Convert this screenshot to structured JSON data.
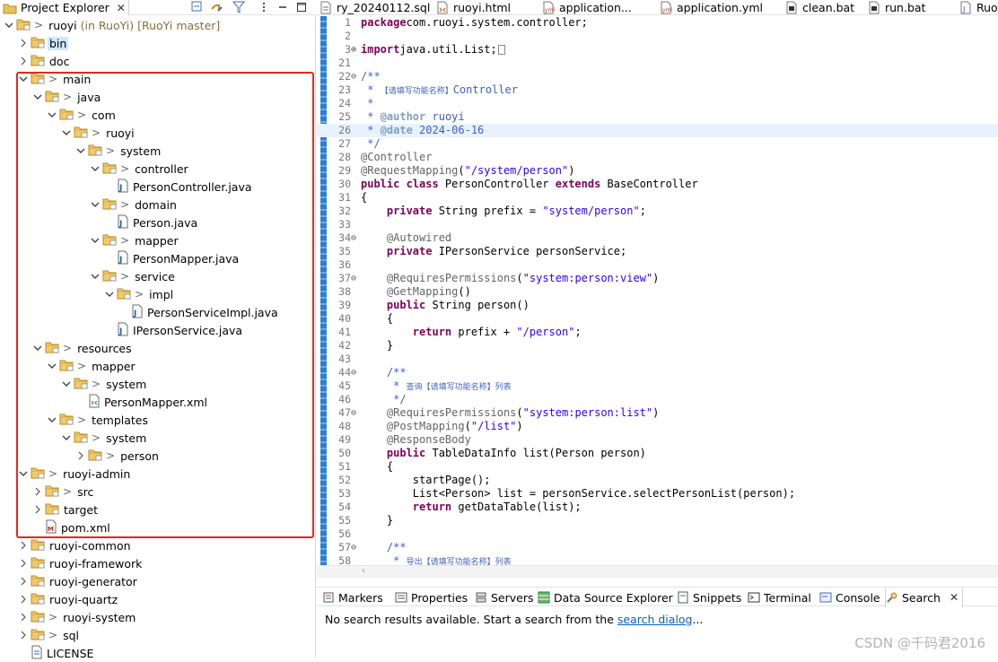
{
  "explorer": {
    "tab_title": "Project Explorer",
    "rows": [
      {
        "depth": 0,
        "twisty": "open",
        "icon": "project",
        "gt": true,
        "label": "ruoyi",
        "suffix": " (in RuoYi) [RuoYi master]"
      },
      {
        "depth": 1,
        "twisty": "closed",
        "icon": "folder",
        "gt": false,
        "label": "bin",
        "selected": true
      },
      {
        "depth": 1,
        "twisty": "closed",
        "icon": "folder",
        "gt": false,
        "label": "doc"
      },
      {
        "depth": 1,
        "twisty": "open",
        "icon": "folder",
        "gt": true,
        "label": "main"
      },
      {
        "depth": 2,
        "twisty": "open",
        "icon": "folder",
        "gt": true,
        "label": "java"
      },
      {
        "depth": 3,
        "twisty": "open",
        "icon": "folder",
        "gt": true,
        "label": "com"
      },
      {
        "depth": 4,
        "twisty": "open",
        "icon": "folder",
        "gt": true,
        "label": "ruoyi"
      },
      {
        "depth": 5,
        "twisty": "open",
        "icon": "folder",
        "gt": true,
        "label": "system"
      },
      {
        "depth": 6,
        "twisty": "open",
        "icon": "folder",
        "gt": true,
        "label": "controller"
      },
      {
        "depth": 7,
        "twisty": "none",
        "icon": "java",
        "gt": false,
        "label": "PersonController.java"
      },
      {
        "depth": 6,
        "twisty": "open",
        "icon": "folder",
        "gt": true,
        "label": "domain"
      },
      {
        "depth": 7,
        "twisty": "none",
        "icon": "java",
        "gt": false,
        "label": "Person.java"
      },
      {
        "depth": 6,
        "twisty": "open",
        "icon": "folder",
        "gt": true,
        "label": "mapper"
      },
      {
        "depth": 7,
        "twisty": "none",
        "icon": "java",
        "gt": false,
        "label": "PersonMapper.java"
      },
      {
        "depth": 6,
        "twisty": "open",
        "icon": "folder",
        "gt": true,
        "label": "service"
      },
      {
        "depth": 7,
        "twisty": "open",
        "icon": "folder",
        "gt": true,
        "label": "impl"
      },
      {
        "depth": 8,
        "twisty": "none",
        "icon": "java",
        "gt": false,
        "label": "PersonServiceImpl.java"
      },
      {
        "depth": 7,
        "twisty": "none",
        "icon": "java",
        "gt": false,
        "label": "IPersonService.java"
      },
      {
        "depth": 2,
        "twisty": "open",
        "icon": "folder",
        "gt": true,
        "label": "resources"
      },
      {
        "depth": 3,
        "twisty": "open",
        "icon": "folder",
        "gt": true,
        "label": "mapper"
      },
      {
        "depth": 4,
        "twisty": "open",
        "icon": "folder",
        "gt": true,
        "label": "system"
      },
      {
        "depth": 5,
        "twisty": "none",
        "icon": "xml",
        "gt": false,
        "label": "PersonMapper.xml"
      },
      {
        "depth": 3,
        "twisty": "open",
        "icon": "folder",
        "gt": true,
        "label": "templates"
      },
      {
        "depth": 4,
        "twisty": "open",
        "icon": "folder",
        "gt": true,
        "label": "system"
      },
      {
        "depth": 5,
        "twisty": "closed",
        "icon": "folder",
        "gt": true,
        "label": "person"
      },
      {
        "depth": 1,
        "twisty": "open",
        "icon": "folder",
        "gt": true,
        "label": "ruoyi-admin"
      },
      {
        "depth": 2,
        "twisty": "closed",
        "icon": "folder",
        "gt": true,
        "label": "src"
      },
      {
        "depth": 2,
        "twisty": "closed",
        "icon": "folder",
        "gt": false,
        "label": "target"
      },
      {
        "depth": 2,
        "twisty": "none",
        "icon": "xmlfile",
        "gt": false,
        "label": "pom.xml"
      },
      {
        "depth": 1,
        "twisty": "closed",
        "icon": "folder",
        "gt": false,
        "label": "ruoyi-common"
      },
      {
        "depth": 1,
        "twisty": "closed",
        "icon": "folder",
        "gt": false,
        "label": "ruoyi-framework"
      },
      {
        "depth": 1,
        "twisty": "closed",
        "icon": "folder",
        "gt": false,
        "label": "ruoyi-generator"
      },
      {
        "depth": 1,
        "twisty": "closed",
        "icon": "folder",
        "gt": false,
        "label": "ruoyi-quartz"
      },
      {
        "depth": 1,
        "twisty": "closed",
        "icon": "folder",
        "gt": true,
        "label": "ruoyi-system"
      },
      {
        "depth": 1,
        "twisty": "closed",
        "icon": "folder",
        "gt": true,
        "label": "sql"
      },
      {
        "depth": 1,
        "twisty": "none",
        "icon": "textfile",
        "gt": false,
        "label": "LICENSE"
      }
    ]
  },
  "editor_tabs": [
    {
      "label": "ry_20240112.sql",
      "icon": "sql-file-icon"
    },
    {
      "label": "ruoyi.html",
      "icon": "html-file-icon"
    },
    {
      "label": "application...",
      "icon": "yml-file-icon"
    },
    {
      "label": "application.yml",
      "icon": "yml-file-icon"
    },
    {
      "label": "clean.bat",
      "icon": "bat-file-icon"
    },
    {
      "label": "run.bat",
      "icon": "bat-file-icon"
    },
    {
      "label": "RuoYi",
      "icon": "java-file-icon"
    }
  ],
  "code_lines": [
    {
      "n": "1",
      "segs": [
        [
          "kw",
          "package"
        ],
        [
          "",
          "com.ruoyi.system.controller;"
        ]
      ]
    },
    {
      "n": "2",
      "segs": []
    },
    {
      "n": "3",
      "fold": "plus",
      "segs": [
        [
          "kw",
          "import"
        ],
        [
          "",
          "java.util.List;"
        ],
        [
          "box",
          ""
        ]
      ]
    },
    {
      "n": "21",
      "segs": []
    },
    {
      "n": "22",
      "fold": "minus",
      "segs": [
        [
          "jd",
          "/**"
        ]
      ]
    },
    {
      "n": "23",
      "segs": [
        [
          "jd",
          " * "
        ],
        [
          "cjk",
          "【请填写功能名称】"
        ],
        [
          "jd",
          "Controller"
        ]
      ]
    },
    {
      "n": "24",
      "segs": [
        [
          "jd",
          " *"
        ]
      ]
    },
    {
      "n": "25",
      "segs": [
        [
          "jd",
          " * "
        ],
        [
          "jdt",
          "@author"
        ],
        [
          "jd",
          " ruoyi"
        ]
      ]
    },
    {
      "n": "26",
      "hl": true,
      "segs": [
        [
          "jd",
          " * "
        ],
        [
          "jdt",
          "@date"
        ],
        [
          "jd",
          " 2024-06-16"
        ]
      ]
    },
    {
      "n": "27",
      "segs": [
        [
          "jd",
          " */"
        ]
      ]
    },
    {
      "n": "28",
      "segs": [
        [
          "ann",
          "@Controller"
        ]
      ]
    },
    {
      "n": "29",
      "segs": [
        [
          "ann",
          "@RequestMapping"
        ],
        [
          "",
          "("
        ],
        [
          "str",
          "\"/system/person\""
        ],
        [
          "",
          ")"
        ]
      ]
    },
    {
      "n": "30",
      "segs": [
        [
          "kw",
          "public class"
        ],
        [
          "",
          " PersonController "
        ],
        [
          "kw",
          "extends"
        ],
        [
          "",
          " BaseController"
        ]
      ]
    },
    {
      "n": "31",
      "segs": [
        [
          "",
          "{"
        ]
      ]
    },
    {
      "n": "32",
      "segs": [
        [
          "",
          "    "
        ],
        [
          "kw",
          "private"
        ],
        [
          "",
          " String prefix = "
        ],
        [
          "str",
          "\"system/person\""
        ],
        [
          "",
          ";"
        ]
      ]
    },
    {
      "n": "33",
      "segs": []
    },
    {
      "n": "34",
      "fold": "minus",
      "segs": [
        [
          "",
          "    "
        ],
        [
          "ann",
          "@Autowired"
        ]
      ]
    },
    {
      "n": "35",
      "segs": [
        [
          "",
          "    "
        ],
        [
          "kw",
          "private"
        ],
        [
          "",
          " IPersonService personService;"
        ]
      ]
    },
    {
      "n": "36",
      "segs": []
    },
    {
      "n": "37",
      "fold": "minus",
      "segs": [
        [
          "",
          "    "
        ],
        [
          "ann",
          "@RequiresPermissions"
        ],
        [
          "",
          "("
        ],
        [
          "str",
          "\"system:person:view\""
        ],
        [
          "",
          ")"
        ]
      ]
    },
    {
      "n": "38",
      "segs": [
        [
          "",
          "    "
        ],
        [
          "ann",
          "@GetMapping"
        ],
        [
          "",
          "()"
        ]
      ]
    },
    {
      "n": "39",
      "segs": [
        [
          "",
          "    "
        ],
        [
          "kw",
          "public"
        ],
        [
          "",
          " String person()"
        ]
      ]
    },
    {
      "n": "40",
      "segs": [
        [
          "",
          "    {"
        ]
      ]
    },
    {
      "n": "41",
      "segs": [
        [
          "",
          "        "
        ],
        [
          "kw",
          "return"
        ],
        [
          "",
          " prefix + "
        ],
        [
          "str",
          "\"/person\""
        ],
        [
          "",
          ";"
        ]
      ]
    },
    {
      "n": "42",
      "segs": [
        [
          "",
          "    }"
        ]
      ]
    },
    {
      "n": "43",
      "segs": []
    },
    {
      "n": "44",
      "fold": "minus",
      "segs": [
        [
          "",
          "    "
        ],
        [
          "jd",
          "/**"
        ]
      ]
    },
    {
      "n": "45",
      "segs": [
        [
          "",
          "    "
        ],
        [
          "jd",
          " * "
        ],
        [
          "cjk",
          "查询【请填写功能名称】列表"
        ]
      ]
    },
    {
      "n": "46",
      "segs": [
        [
          "",
          "    "
        ],
        [
          "jd",
          " */"
        ]
      ]
    },
    {
      "n": "47",
      "fold": "minus",
      "segs": [
        [
          "",
          "    "
        ],
        [
          "ann",
          "@RequiresPermissions"
        ],
        [
          "",
          "("
        ],
        [
          "str",
          "\"system:person:list\""
        ],
        [
          "",
          ")"
        ]
      ]
    },
    {
      "n": "48",
      "segs": [
        [
          "",
          "    "
        ],
        [
          "ann",
          "@PostMapping"
        ],
        [
          "",
          "("
        ],
        [
          "str",
          "\"/list\""
        ],
        [
          "",
          ")"
        ]
      ]
    },
    {
      "n": "49",
      "segs": [
        [
          "",
          "    "
        ],
        [
          "ann",
          "@ResponseBody"
        ]
      ]
    },
    {
      "n": "50",
      "segs": [
        [
          "",
          "    "
        ],
        [
          "kw",
          "public"
        ],
        [
          "",
          " TableDataInfo list(Person person)"
        ]
      ]
    },
    {
      "n": "51",
      "segs": [
        [
          "",
          "    {"
        ]
      ]
    },
    {
      "n": "52",
      "segs": [
        [
          "",
          "        startPage();"
        ]
      ]
    },
    {
      "n": "53",
      "segs": [
        [
          "",
          "        List<Person> list = personService.selectPersonList(person);"
        ]
      ]
    },
    {
      "n": "54",
      "segs": [
        [
          "",
          "        "
        ],
        [
          "kw",
          "return"
        ],
        [
          "",
          " getDataTable(list);"
        ]
      ]
    },
    {
      "n": "55",
      "segs": [
        [
          "",
          "    }"
        ]
      ]
    },
    {
      "n": "56",
      "segs": []
    },
    {
      "n": "57",
      "fold": "minus",
      "segs": [
        [
          "",
          "    "
        ],
        [
          "jd",
          "/**"
        ]
      ]
    },
    {
      "n": "58",
      "segs": [
        [
          "",
          "    "
        ],
        [
          "jd",
          " * "
        ],
        [
          "cjk",
          "导出【请填写功能名称】列表"
        ]
      ]
    }
  ],
  "bottom_tabs": [
    {
      "label": "Markers",
      "icon": "markers-icon"
    },
    {
      "label": "Properties",
      "icon": "properties-icon"
    },
    {
      "label": "Servers",
      "icon": "servers-icon"
    },
    {
      "label": "Data Source Explorer",
      "icon": "data-source-icon"
    },
    {
      "label": "Snippets",
      "icon": "snippets-icon"
    },
    {
      "label": "Terminal",
      "icon": "terminal-icon"
    },
    {
      "label": "Console",
      "icon": "console-icon"
    },
    {
      "label": "Search",
      "icon": "search-icon",
      "active": true
    }
  ],
  "search_panel": {
    "message": "No search results available. Start a search from the ",
    "link": "search dialog",
    "trailing": "..."
  },
  "watermark": "CSDN @千码君2016",
  "colors": {
    "highlight_box": "#e8271c",
    "selection": "#cce8ff",
    "keyword": "#7f0055",
    "string": "#2a00ff",
    "javadoc": "#3f5fbf"
  }
}
